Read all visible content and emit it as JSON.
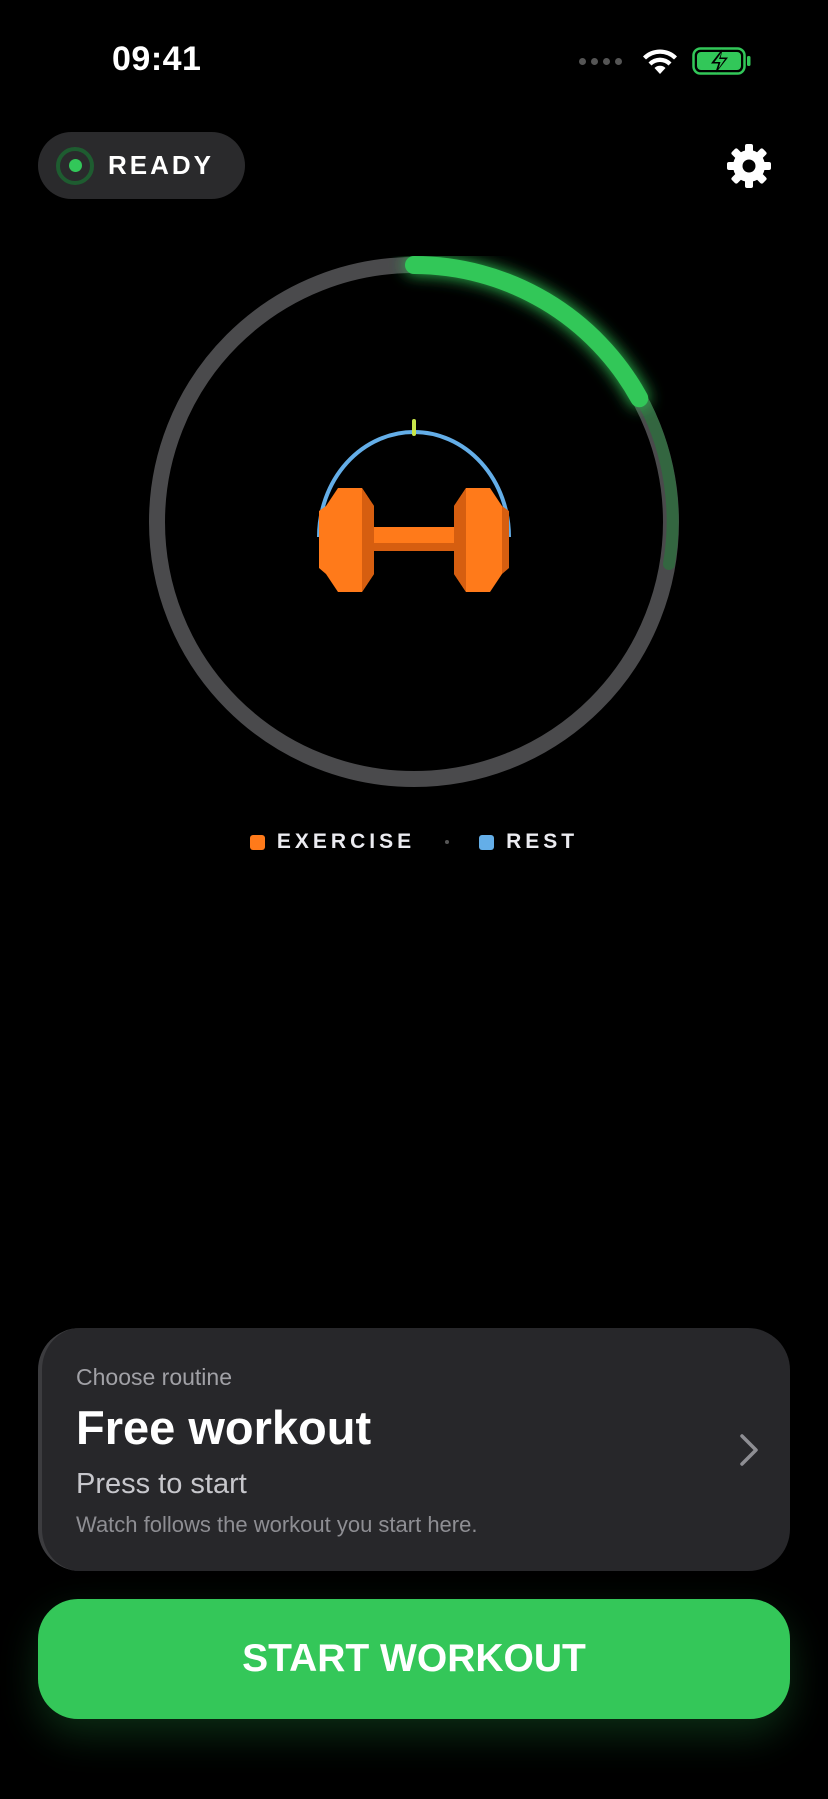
{
  "status_bar": {
    "time": "09:41",
    "icons": [
      "signal-dots-icon",
      "wifi-icon",
      "battery-charging-icon"
    ]
  },
  "header": {
    "status_label": "READY",
    "status_color": "#32c759",
    "settings_icon": "gear-icon"
  },
  "dial": {
    "center_icon": "dumbbell-icon",
    "progress_fraction": 0.17,
    "colors": {
      "track": "#4a4a4c",
      "progress": "#32c759",
      "exercise": "#ff7a1a",
      "rest": "#64aee8",
      "marker": "#c8e64a"
    }
  },
  "legend": {
    "exercise_label": "EXERCISE",
    "rest_label": "REST"
  },
  "routine_card": {
    "label": "Choose routine",
    "title": "Free workout",
    "subtitle": "Press to start",
    "note": "Watch follows the workout you start here.",
    "icon": "chevron-right-icon"
  },
  "start_button": {
    "label": "START WORKOUT",
    "color": "#34c759"
  }
}
